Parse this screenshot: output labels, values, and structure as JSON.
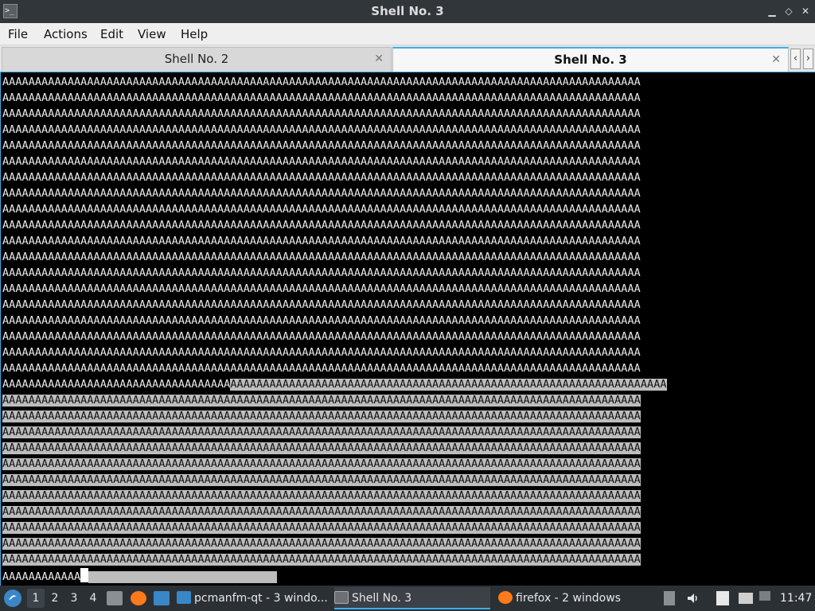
{
  "window": {
    "title": "Shell No. 3",
    "app_icon_glyph": ">_",
    "controls": {
      "minimize": "▁",
      "maximize": "◇",
      "close": "✕"
    }
  },
  "menubar": {
    "items": [
      "File",
      "Actions",
      "Edit",
      "View",
      "Help"
    ]
  },
  "tabs": [
    {
      "label": "Shell No. 2",
      "active": false,
      "close": "✕"
    },
    {
      "label": "Shell No. 3",
      "active": true,
      "close": "✕"
    }
  ],
  "tab_scroll": {
    "left": "‹",
    "right": "›"
  },
  "terminal": {
    "full_line": "AAAAAAAAAAAAAAAAAAAAAAAAAAAAAAAAAAAAAAAAAAAAAAAAAAAAAAAAAAAAAAAAAAAAAAAAAAAAAAAAAAAAAAAAAAAAAAAAAA",
    "unselected_line_count": 19,
    "partial_selected_line": {
      "plain": "AAAAAAAAAAAAAAAAAAAAAAAAAAAAAAAAAAA",
      "selected": "AAAAAAAAAAAAAAAAAAAAAAAAAAAAAAAAAAAAAAAAAAAAAAAAAAAAAAAAAAAAAAAAAAA"
    },
    "selected_line_count": 11,
    "last_line": "AAAAAAAAAAAA",
    "last_line_selected_tail": "                             ",
    "colors": {
      "background": "#000000",
      "foreground": "#eaeaea",
      "selection": "#bdbdbd"
    }
  },
  "taskbar": {
    "start_icon": "start-menu-icon",
    "desktops": [
      "1",
      "2",
      "3",
      "4"
    ],
    "active_desktop": "1",
    "launchers": [
      "file-manager-icon",
      "firefox-icon",
      "show-desktop-icon"
    ],
    "tasks": [
      {
        "label": "pcmanfm-qt - 3 windo...",
        "icon": "folder-icon",
        "active": false
      },
      {
        "label": "Shell No. 3",
        "icon": "terminal-icon",
        "active": true
      },
      {
        "label": "firefox - 2 windows",
        "icon": "firefox-icon",
        "active": false
      }
    ],
    "tray": [
      "storage-icon",
      "volume-icon",
      "clipboard-icon",
      "network-icon"
    ],
    "clock": "11:47"
  },
  "accent_color": "#3daee9"
}
